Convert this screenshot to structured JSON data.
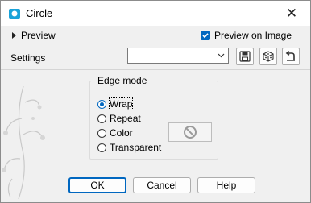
{
  "window": {
    "title": "Circle",
    "close_glyph": "✕"
  },
  "preview": {
    "toggle_label": "Preview",
    "preview_on_image_label": "Preview on Image",
    "preview_on_image_checked": true
  },
  "settings": {
    "label": "Settings",
    "preset_value": ""
  },
  "edge_mode": {
    "title": "Edge mode",
    "options": [
      {
        "label": "Wrap",
        "selected": true
      },
      {
        "label": "Repeat",
        "selected": false
      },
      {
        "label": "Color",
        "selected": false
      },
      {
        "label": "Transparent",
        "selected": false
      }
    ]
  },
  "buttons": {
    "ok": "OK",
    "cancel": "Cancel",
    "help": "Help"
  },
  "icons": {
    "app": "app-icon",
    "save": "save-preset-icon",
    "randomize": "dice-icon",
    "reset": "reset-icon",
    "no_color": "prohibited-icon"
  },
  "colors": {
    "accent": "#0067c0"
  }
}
